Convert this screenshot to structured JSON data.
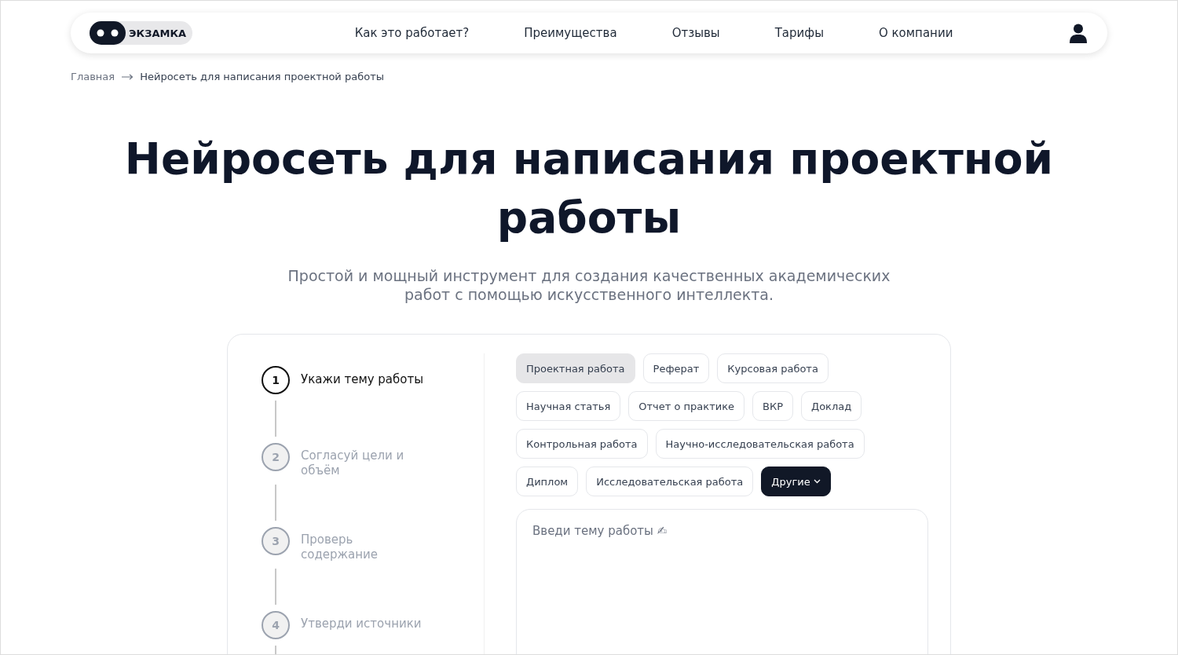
{
  "header": {
    "logo": "ЭКЗАМКА",
    "nav": [
      "Как это работает?",
      "Преимущества",
      "Отзывы",
      "Тарифы",
      "О компании"
    ]
  },
  "breadcrumbs": [
    "Главная",
    "Нейросеть для написания проектной работы"
  ],
  "title": "Нейросеть для написания проектной работы",
  "subtitle": "Простой и мощный инструмент для создания качественных академических работ с помощью искусственного интеллекта.",
  "steps": [
    {
      "number": "1",
      "label": "Укажи тему работы",
      "selected": true
    },
    {
      "number": "2",
      "label": "Согласуй цели и объём",
      "selected": false
    },
    {
      "number": "3",
      "label": "Проверь содержание",
      "selected": false
    },
    {
      "number": "4",
      "label": "Утверди источники",
      "selected": false
    }
  ],
  "work_types": [
    {
      "label": "Проектная работа",
      "selected": true,
      "kind": "chip"
    },
    {
      "label": "Реферат",
      "selected": false,
      "kind": "chip"
    },
    {
      "label": "Курсовая работа",
      "selected": false,
      "kind": "chip"
    },
    {
      "label": "Научная статья",
      "selected": false,
      "kind": "chip"
    },
    {
      "label": "Отчет о практике",
      "selected": false,
      "kind": "chip"
    },
    {
      "label": "ВКР",
      "selected": false,
      "kind": "chip"
    },
    {
      "label": "Доклад",
      "selected": false,
      "kind": "chip"
    },
    {
      "label": "Контрольная работа",
      "selected": false,
      "kind": "chip"
    },
    {
      "label": "Научно-исследовательская работа",
      "selected": false,
      "kind": "chip"
    },
    {
      "label": "Диплом",
      "selected": false,
      "kind": "chip"
    },
    {
      "label": "Исследовательская работа",
      "selected": false,
      "kind": "chip"
    },
    {
      "label": "Другие",
      "selected": false,
      "kind": "dropdown"
    }
  ],
  "topic_field": {
    "placeholder": "Введи тему работы ✍"
  }
}
